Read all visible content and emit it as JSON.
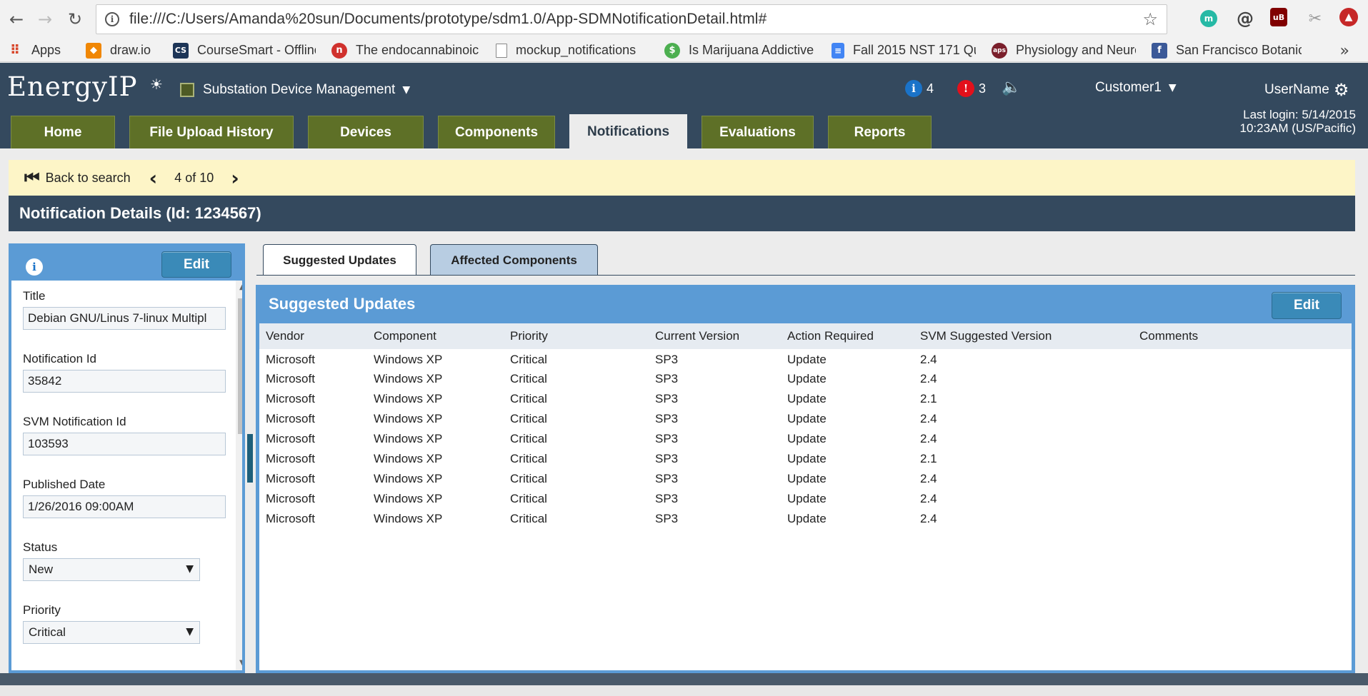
{
  "browser": {
    "url": "file:///C:/Users/Amanda%20sun/Documents/prototype/sdm1.0/App-SDMNotificationDetail.html#",
    "bookmarks": [
      {
        "label": "Apps",
        "icon": "apps-grid-icon",
        "color": "#d8472b"
      },
      {
        "label": "draw.io",
        "icon": "drawio-icon",
        "color": "#f08705"
      },
      {
        "label": "CourseSmart - Offline",
        "icon": "coursesmart-icon",
        "color": "#1d3557"
      },
      {
        "label": "The endocannabinoic",
        "icon": "n-logo-icon",
        "color": "#d0312d"
      },
      {
        "label": "mockup_notifications",
        "icon": "document-icon",
        "color": "#ffffff"
      },
      {
        "label": "Is Marijuana Addictive",
        "icon": "dollar-badge-icon",
        "color": "#4caf50"
      },
      {
        "label": "Fall 2015 NST 171 Qu",
        "icon": "google-doc-icon",
        "color": "#4285f4"
      },
      {
        "label": "Physiology and Neuro",
        "icon": "aps-logo-icon",
        "color": "#7a1f2b"
      },
      {
        "label": "San Francisco Botanic",
        "icon": "facebook-icon",
        "color": "#3b5998"
      }
    ],
    "more": "»"
  },
  "app": {
    "logo": "EnergyIP",
    "app_name": "Substation Device Management",
    "info_count": "4",
    "alert_count": "3",
    "customer": "Customer1",
    "username": "UserName",
    "last_login_line1": "Last login: 5/14/2015",
    "last_login_line2": "10:23AM (US/Pacific)",
    "tabs": [
      {
        "label": "Home",
        "active": false
      },
      {
        "label": "File Upload History",
        "active": false
      },
      {
        "label": "Devices",
        "active": false
      },
      {
        "label": "Components",
        "active": false
      },
      {
        "label": "Notifications",
        "active": true
      },
      {
        "label": "Evaluations",
        "active": false
      },
      {
        "label": "Reports",
        "active": false
      }
    ],
    "accent_color": "#5e7027",
    "header_color": "#34495e"
  },
  "pager": {
    "back_label": "Back to search",
    "position": "4 of 10"
  },
  "detail": {
    "title": "Notification Details (Id: 1234567)"
  },
  "left_panel": {
    "edit_label": "Edit",
    "fields": {
      "title_label": "Title",
      "title_value": "Debian GNU/Linus 7-linux Multipl",
      "notification_id_label": "Notification Id",
      "notification_id_value": "35842",
      "svm_notification_id_label": "SVM Notification Id",
      "svm_notification_id_value": "103593",
      "published_date_label": "Published Date",
      "published_date_value": "1/26/2016 09:00AM",
      "status_label": "Status",
      "status_value": "New",
      "priority_label": "Priority",
      "priority_value": "Critical"
    }
  },
  "right_panel": {
    "tabs": [
      {
        "label": "Suggested Updates",
        "active": true
      },
      {
        "label": "Affected Components",
        "active": false
      }
    ],
    "title": "Suggested Updates",
    "edit_label": "Edit",
    "columns": [
      "Vendor",
      "Component",
      "Priority",
      "Current Version",
      "Action Required",
      "SVM Suggested Version",
      "Comments"
    ],
    "rows": [
      [
        "Microsoft",
        "Windows XP",
        "Critical",
        "SP3",
        "Update",
        "2.4",
        ""
      ],
      [
        "Microsoft",
        "Windows XP",
        "Critical",
        "SP3",
        "Update",
        "2.4",
        ""
      ],
      [
        "Microsoft",
        "Windows XP",
        "Critical",
        "SP3",
        "Update",
        "2.1",
        ""
      ],
      [
        "Microsoft",
        "Windows XP",
        "Critical",
        "SP3",
        "Update",
        "2.4",
        ""
      ],
      [
        "Microsoft",
        "Windows XP",
        "Critical",
        "SP3",
        "Update",
        "2.4",
        ""
      ],
      [
        "Microsoft",
        "Windows XP",
        "Critical",
        "SP3",
        "Update",
        "2.1",
        ""
      ],
      [
        "Microsoft",
        "Windows XP",
        "Critical",
        "SP3",
        "Update",
        "2.4",
        ""
      ],
      [
        "Microsoft",
        "Windows XP",
        "Critical",
        "SP3",
        "Update",
        "2.4",
        ""
      ],
      [
        "Microsoft",
        "Windows XP",
        "Critical",
        "SP3",
        "Update",
        "2.4",
        ""
      ]
    ]
  }
}
